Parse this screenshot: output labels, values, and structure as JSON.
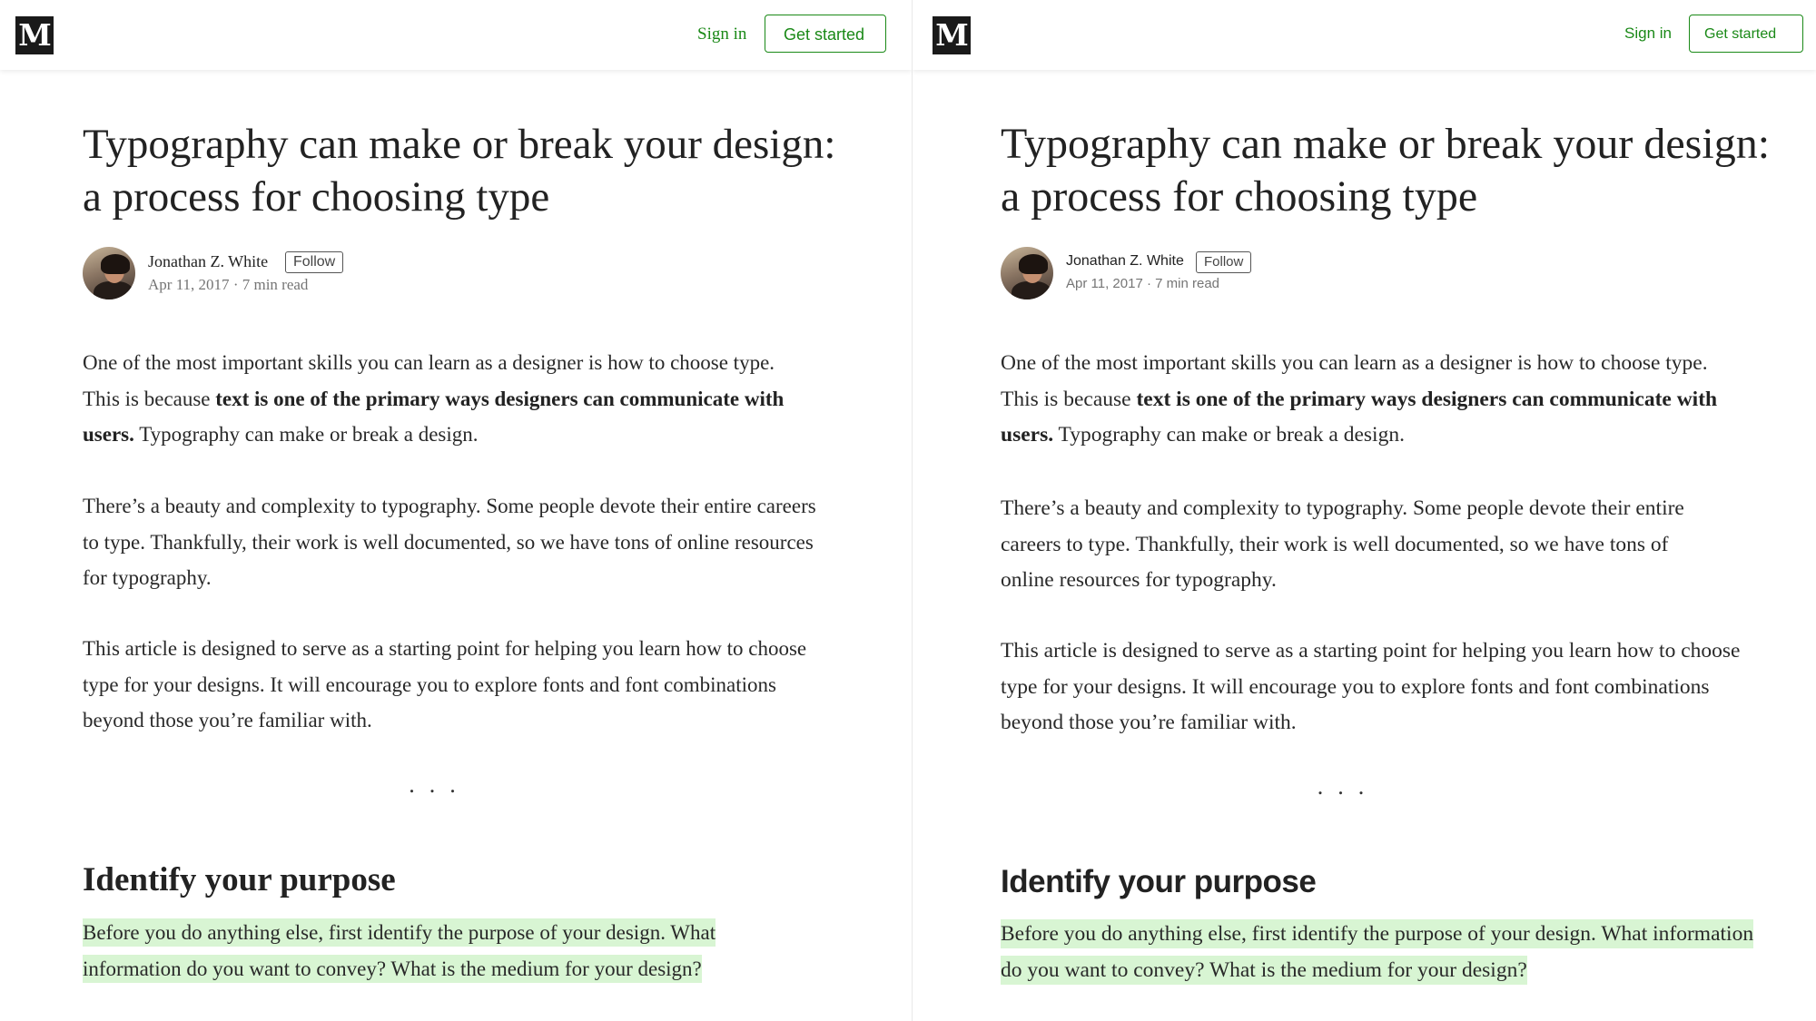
{
  "brand": {
    "logo_letter": "M"
  },
  "nav": {
    "signin": "Sign in",
    "get_started": "Get started"
  },
  "article": {
    "title": "Typography can make or break your design: a process for choosing type",
    "author": "Jonathan Z. White",
    "follow": "Follow",
    "date": "Apr 11, 2017",
    "meta_sep": " · ",
    "read_time": "7 min read",
    "p1_a": "One of the most important skills you can learn as a designer is how to choose type. This is because ",
    "p1_bold": "text is one of the primary ways designers can communicate with users.",
    "p1_b": " Typography can make or break a design.",
    "p2": "There’s a beauty and complexity to typography. Some people devote their entire careers to type. Thankfully, their work is well documented, so we have tons of online resources for typography.",
    "p3": "This article is designed to serve as a starting point for helping you learn how to choose type for your designs. It will encourage you to explore fonts and font combinations beyond those you’re familiar with.",
    "separator": "...",
    "section_heading": "Identify your purpose",
    "p4": "Before you do anything else, first identify the purpose of your design. What information do you want to convey? What is the medium for your design?"
  },
  "colors": {
    "brand_green": "#1a8917",
    "highlight": "#d8f5d3",
    "logo_bg": "#1a1a1a"
  }
}
